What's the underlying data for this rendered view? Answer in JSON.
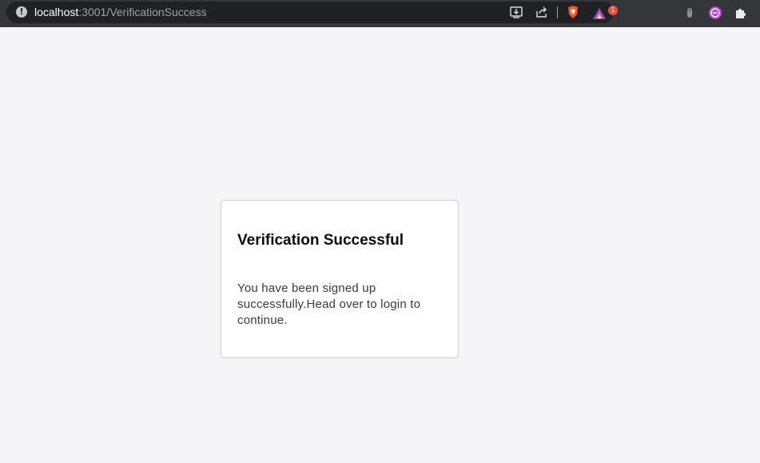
{
  "browser": {
    "url_host": "localhost",
    "url_path": ":3001/VerificationSuccess",
    "extension_badge_count": "1",
    "icons": [
      "info-icon",
      "install-app-icon",
      "share-icon",
      "brave-shields-icon",
      "brave-rewards-icon",
      "mouse-icon",
      "extension-avatar-icon",
      "puzzle-icon"
    ]
  },
  "card": {
    "title": "Verification Successful",
    "message": "You have been signed up successfully.Head over to login to continue."
  }
}
